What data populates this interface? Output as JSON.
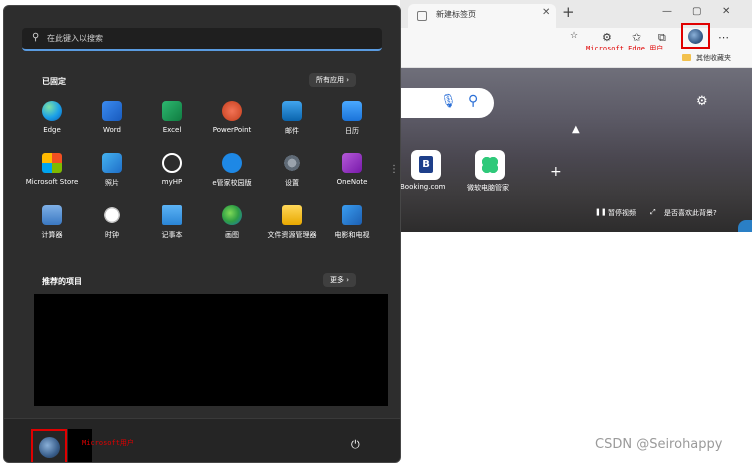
{
  "edge": {
    "tab_title": "新建标签页",
    "profile_annotation": "Microsoft Edge 用户",
    "favorites_folder": "其他收藏夹",
    "tiles": [
      {
        "label": "Booking.com",
        "letter": "B"
      },
      {
        "label": "微软电脑管家",
        "letter": ""
      }
    ],
    "pause_video": "暂停视频",
    "background_question": "是否喜欢此背景?"
  },
  "start_menu": {
    "search_placeholder": "在此键入以搜索",
    "pinned_title": "已固定",
    "all_apps": "所有应用",
    "pinned_apps": [
      {
        "label": "Edge",
        "icon": "edge-icon"
      },
      {
        "label": "Word",
        "icon": "word-icon"
      },
      {
        "label": "Excel",
        "icon": "excel-icon"
      },
      {
        "label": "PowerPoint",
        "icon": "powerpoint-icon"
      },
      {
        "label": "邮件",
        "icon": "mail-icon"
      },
      {
        "label": "日历",
        "icon": "calendar-icon"
      },
      {
        "label": "Microsoft Store",
        "icon": "store-icon"
      },
      {
        "label": "照片",
        "icon": "photos-icon"
      },
      {
        "label": "myHP",
        "icon": "hp-icon"
      },
      {
        "label": "e管家校园版",
        "icon": "e-manager-icon"
      },
      {
        "label": "设置",
        "icon": "settings-icon"
      },
      {
        "label": "OneNote",
        "icon": "onenote-icon"
      },
      {
        "label": "计算器",
        "icon": "calculator-icon"
      },
      {
        "label": "时钟",
        "icon": "clock-icon"
      },
      {
        "label": "记事本",
        "icon": "notepad-icon"
      },
      {
        "label": "画图",
        "icon": "paint-icon"
      },
      {
        "label": "文件资源管理器",
        "icon": "folder-icon"
      },
      {
        "label": "电影和电视",
        "icon": "movies-icon"
      }
    ],
    "recommended_title": "推荐的项目",
    "more": "更多",
    "user_annotation": "Microsoft用户"
  },
  "watermark": "CSDN @Seirohappy"
}
